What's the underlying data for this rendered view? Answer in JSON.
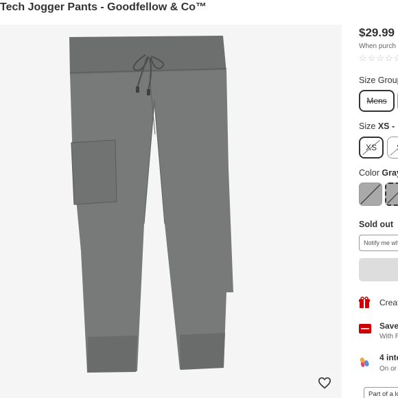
{
  "product": {
    "title": "Tech Jogger Pants - Goodfellow & Co™"
  },
  "icons": {
    "favorite": "heart-outline-icon",
    "circle_offer": "gift-bullseye-icon",
    "redcard": "redcard-icon",
    "installments": "pay-in-4-icon"
  },
  "pricing": {
    "price": "$29.99",
    "when_purchased": "When purch",
    "rating_stars": "☆☆☆☆☆"
  },
  "size_group": {
    "label": "Size Group",
    "options": [
      {
        "label": "Mens",
        "selected": true,
        "unavailable": true
      },
      {
        "label": "",
        "selected": false,
        "unavailable": false
      }
    ]
  },
  "size": {
    "label": "Size",
    "value": "XS - ",
    "options": [
      {
        "label": "XS",
        "selected": true,
        "unavailable": true
      },
      {
        "label": "S",
        "selected": false,
        "unavailable": true
      }
    ]
  },
  "color": {
    "label": "Color",
    "value": "Gray",
    "hex": "#a9a9a9",
    "accent_hex": "#333333"
  },
  "stock": {
    "status": "Sold out",
    "notify_label": "Notify me wh"
  },
  "promos": [
    {
      "title": "Creat",
      "subtitle": ""
    },
    {
      "title": "Save",
      "subtitle": "With R"
    },
    {
      "title": "4 inte",
      "subtitle": "On or"
    }
  ],
  "footer": {
    "label": "Part of a lo"
  }
}
